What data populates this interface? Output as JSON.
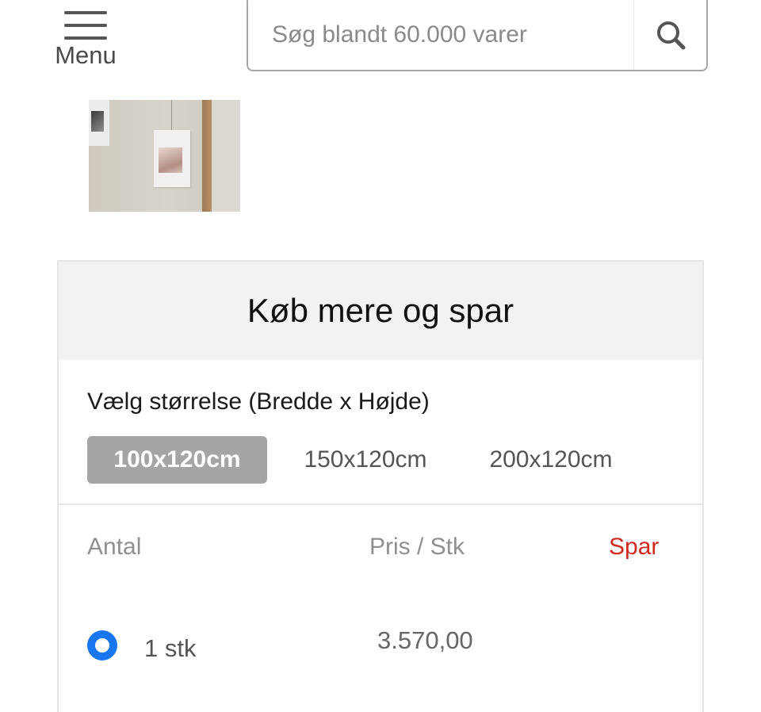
{
  "header": {
    "menu_label": "Menu",
    "search_placeholder": "Søg blandt 60.000 varer"
  },
  "icons": {
    "menu": "hamburger-icon",
    "search": "magnifier-icon"
  },
  "product": {
    "thumbnail_alt": "product thumbnail"
  },
  "bulk": {
    "title": "Køb mere og spar",
    "size_label": "Vælg størrelse (Bredde x Højde)",
    "sizes": [
      "100x120cm",
      "150x120cm",
      "200x120cm"
    ],
    "selected_size": "100x120cm",
    "columns": {
      "quantity": "Antal",
      "price": "Pris / Stk",
      "save": "Spar"
    },
    "rows": [
      {
        "quantity": "1 stk",
        "price": "3.570,00",
        "save": "",
        "selected": true
      }
    ]
  },
  "colors": {
    "accent_blue": "#1877ee",
    "save_red": "#cf2a1e",
    "active_size_bg": "#a5a5a5"
  }
}
